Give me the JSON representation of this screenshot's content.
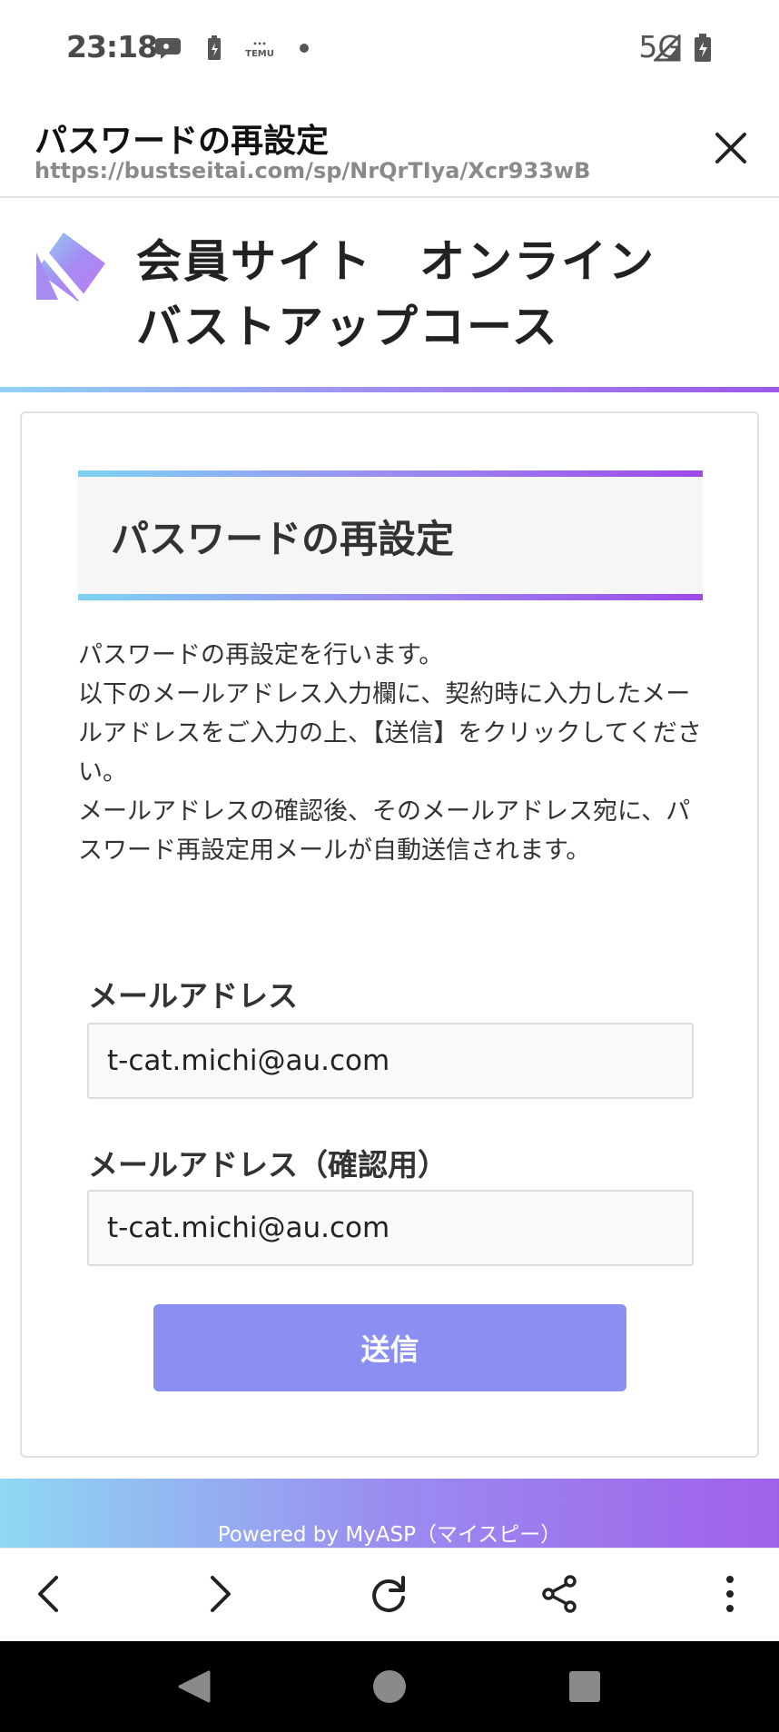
{
  "status_bar": {
    "time": "23:18",
    "notification_icons": [
      "chat-bubble-icon",
      "battery-saver-icon",
      "temu-icon",
      "dot-icon"
    ],
    "network": "5G"
  },
  "custom_tab": {
    "title": "パスワードの再設定",
    "url": "https://bustseitai.com/sp/NrQrTIya/Xcr933wB"
  },
  "site": {
    "title_line1": "会員サイト　オンライン",
    "title_line2": "バストアップコース"
  },
  "section": {
    "heading": "パスワードの再設定",
    "description": [
      "パスワードの再設定を行います。",
      "以下のメールアドレス入力欄に、契約時に入力したメールアドレスをご入力の上、【送信】をクリックしてください。",
      "メールアドレスの確認後、そのメールアドレス宛に、パスワード再設定用メールが自動送信されます。"
    ]
  },
  "form": {
    "email_label": "メールアドレス",
    "email_value": "t-cat.michi@au.com",
    "email_confirm_label": "メールアドレス（確認用）",
    "email_confirm_value": "t-cat.michi@au.com",
    "submit_label": "送信"
  },
  "footer": {
    "powered_by": "Powered by MyASP（マイスピー）"
  },
  "browser_nav": [
    "back-icon",
    "forward-icon",
    "reload-icon",
    "share-icon",
    "more-icon"
  ],
  "system_nav": [
    "back-triangle-icon",
    "home-circle-icon",
    "recents-square-icon"
  ],
  "colors": {
    "accent_gradient_start": "#7dd3f3",
    "accent_gradient_end": "#9e4ae8",
    "submit_button": "#8b8ff2"
  }
}
